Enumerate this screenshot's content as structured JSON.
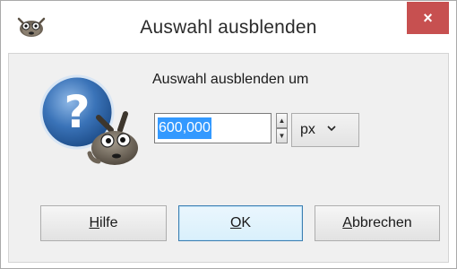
{
  "window": {
    "title": "Auswahl ausblenden",
    "close_glyph": "×",
    "close_color": "#c75050",
    "title_icon": "gimp-wilber-icon"
  },
  "dialog": {
    "icon": "question-wilber-icon",
    "prompt": "Auswahl ausblenden um",
    "amount_value": "600,000",
    "unit_value": "px",
    "selection_color": "#3399ff"
  },
  "buttons": {
    "help": {
      "mnemonic": "H",
      "rest": "ilfe"
    },
    "ok": {
      "mnemonic": "O",
      "rest": "K"
    },
    "cancel": {
      "mnemonic": "A",
      "rest": "bbrechen"
    }
  }
}
